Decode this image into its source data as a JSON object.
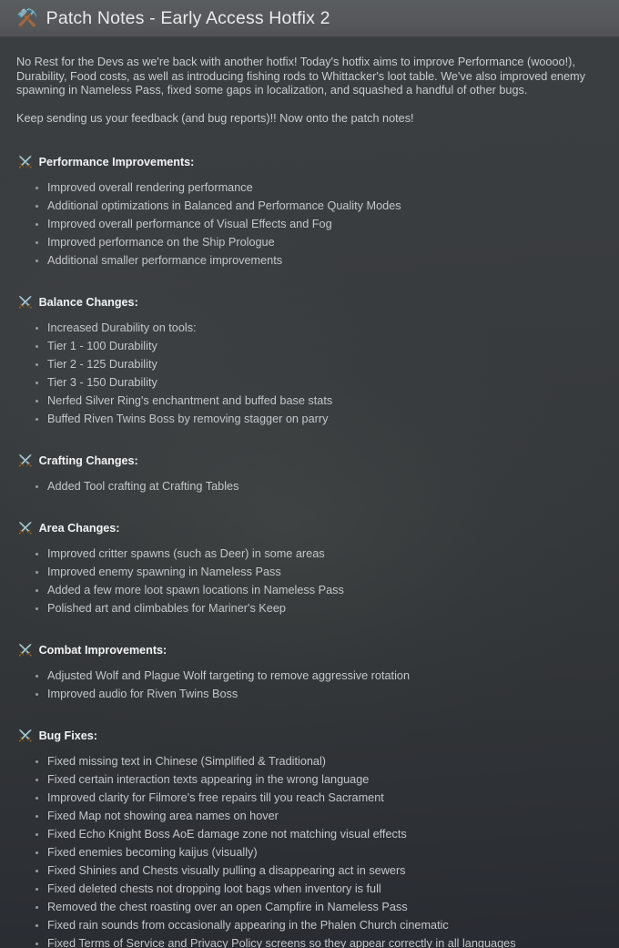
{
  "header": {
    "icon": "hammer-and-wrench-icon",
    "icon_glyph": "⚒️",
    "title": "Patch Notes - Early Access Hotfix 2",
    "band_color": "#56585b",
    "title_color": "#e9eaec"
  },
  "page": {
    "background_color": "#36393c",
    "text_color": "#c4c6c9",
    "heading_color": "#f1f2f3"
  },
  "intro": {
    "paragraph_1": "No Rest for the Devs as we're back with another hotfix! Today's hotfix aims to improve Performance (woooo!), Durability, Food costs, as well as introducing fishing rods to Whittacker's loot table. We've also improved enemy spawning in Nameless Pass, fixed some gaps in localization, and squashed a handful of other bugs.",
    "paragraph_2": "Keep sending us your feedback (and bug reports)!! Now onto the patch notes!"
  },
  "section_icon": "crossed-swords-icon",
  "section_icon_glyph": "⚔️",
  "sections": [
    {
      "title": "Performance Improvements:",
      "items": [
        "Improved overall rendering performance",
        "Additional optimizations in Balanced and Performance Quality Modes",
        "Improved overall performance of Visual Effects and Fog",
        "Improved performance on the Ship Prologue",
        "Additional smaller performance improvements"
      ]
    },
    {
      "title": "Balance Changes:",
      "items": [
        "Increased Durability on tools:",
        "Tier 1 - 100 Durability",
        "Tier 2 - 125 Durability",
        "Tier 3 - 150 Durability",
        "Nerfed Silver Ring's enchantment and buffed base stats",
        "Buffed Riven Twins Boss by removing stagger on parry"
      ]
    },
    {
      "title": "Crafting Changes:",
      "items": [
        "Added Tool crafting at Crafting Tables"
      ]
    },
    {
      "title": "Area Changes:",
      "items": [
        "Improved critter spawns (such as Deer) in some areas",
        "Improved enemy spawning in Nameless Pass",
        "Added a few more loot spawn locations in Nameless Pass",
        "Polished art and climbables for Mariner's Keep"
      ]
    },
    {
      "title": "Combat Improvements:",
      "items": [
        "Adjusted Wolf and Plague Wolf targeting to remove aggressive rotation",
        "Improved audio for Riven Twins Boss"
      ]
    },
    {
      "title": "Bug Fixes:",
      "items": [
        "Fixed missing text in Chinese (Simplified & Traditional)",
        "Fixed certain interaction texts appearing in the wrong language",
        "Improved clarity for Filmore's free repairs till you reach Sacrament",
        "Fixed Map not showing area names on hover",
        "Fixed Echo Knight Boss AoE damage zone not matching visual effects",
        "Fixed enemies becoming kaijus (visually)",
        "Fixed Shinies and Chests visually pulling a disappearing act in sewers",
        "Fixed deleted chests not dropping loot bags when inventory is full",
        "Removed the chest roasting over an open Campfire in Nameless Pass",
        "Fixed rain sounds from occasionally appearing in the Phalen Church cinematic",
        "Fixed Terms of Service and Privacy Policy screens so they appear correctly in all languages"
      ]
    }
  ]
}
